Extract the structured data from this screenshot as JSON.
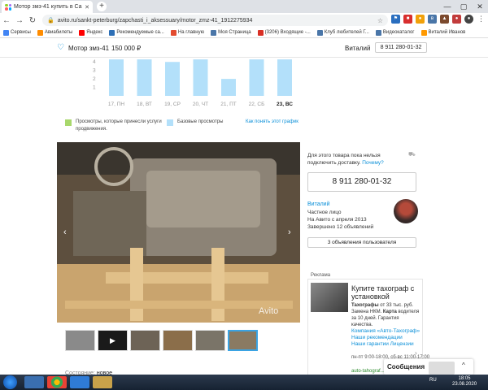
{
  "browser": {
    "tab_title": "Мотор змз-41 купить в Санкт-...",
    "url": "avito.ru/sankt-peterburg/zapchasti_i_aksessuary/motor_zmz-41_1912275934",
    "bookmarks": [
      {
        "label": "Сервисы",
        "color": "#4285f4"
      },
      {
        "label": "Авиабилеты",
        "color": "#ff8c00"
      },
      {
        "label": "Яндекс",
        "color": "#ff0000"
      },
      {
        "label": "Рекомендуемые са...",
        "color": "#2d6fb6"
      },
      {
        "label": "На главную",
        "color": "#e34b2f"
      },
      {
        "label": "Моя Страница",
        "color": "#4a76a8"
      },
      {
        "label": "(3206) Входящие -...",
        "color": "#d93025"
      },
      {
        "label": "Клуб любителей Г...",
        "color": "#4a76a8"
      },
      {
        "label": "Видеокаталог",
        "color": "#4a76a8"
      },
      {
        "label": "Виталий Иванов",
        "color": "#ff9900"
      }
    ]
  },
  "header": {
    "title": "Мотор змз-41",
    "price": "150 000 ₽",
    "seller": "Виталий",
    "phone": "8 911 280-01-32"
  },
  "chart_data": {
    "type": "bar",
    "categories": [
      "17, ПН",
      "18, ВТ",
      "19, СР",
      "20, ЧТ",
      "21, ПТ",
      "22, СБ",
      "23, ВС"
    ],
    "values": [
      4.3,
      4.3,
      4.0,
      4.3,
      2.0,
      4.3,
      4.3
    ],
    "ylim": [
      0,
      4.5
    ],
    "yticks": [
      "4",
      "3",
      "2",
      "1"
    ],
    "legend": [
      {
        "label": "Просмотры, которые принесли услуги продвижения.",
        "color": "#a8d86c"
      },
      {
        "label": "Базовые просмотры",
        "color": "#b3e0fa"
      }
    ],
    "legend_link": "Как понять этот график"
  },
  "gallery": {
    "watermark": "Avito",
    "condition_label": "Состояние:",
    "condition_value": "новое"
  },
  "sidebar": {
    "delivery_note": "Для этого товара пока нельзя подключить доставку.",
    "why_link": "Почему?",
    "phone": "8 911 280-01-32",
    "seller_name": "Виталий",
    "seller_type": "Частное лицо",
    "since": "На Авито с апреля 2013",
    "completed": "Завершено 12 объявлений",
    "ads_button": "3 объявления пользователя"
  },
  "ad": {
    "label": "Реклама",
    "title": "Купите тахограф с установкой",
    "text_bold": "Тахографы",
    "text": "от 33 тыс. руб. Замена НКМ.",
    "text_bold2": "Карта",
    "text2": "водителя за 10 дней. Гарантия качества.",
    "links": [
      "Компания «Авто-Тахограф»",
      "Наши рекомендации",
      "Наши гарантии   Лицензии"
    ],
    "hours": "пн-пт 9:00-18:00, сб-вс 11:00-17:00",
    "site": "auto-tahograf..."
  },
  "messages": {
    "label": "Сообщения"
  },
  "taskbar": {
    "lang": "RU",
    "time": "18:05",
    "date": "23.08.2020"
  }
}
